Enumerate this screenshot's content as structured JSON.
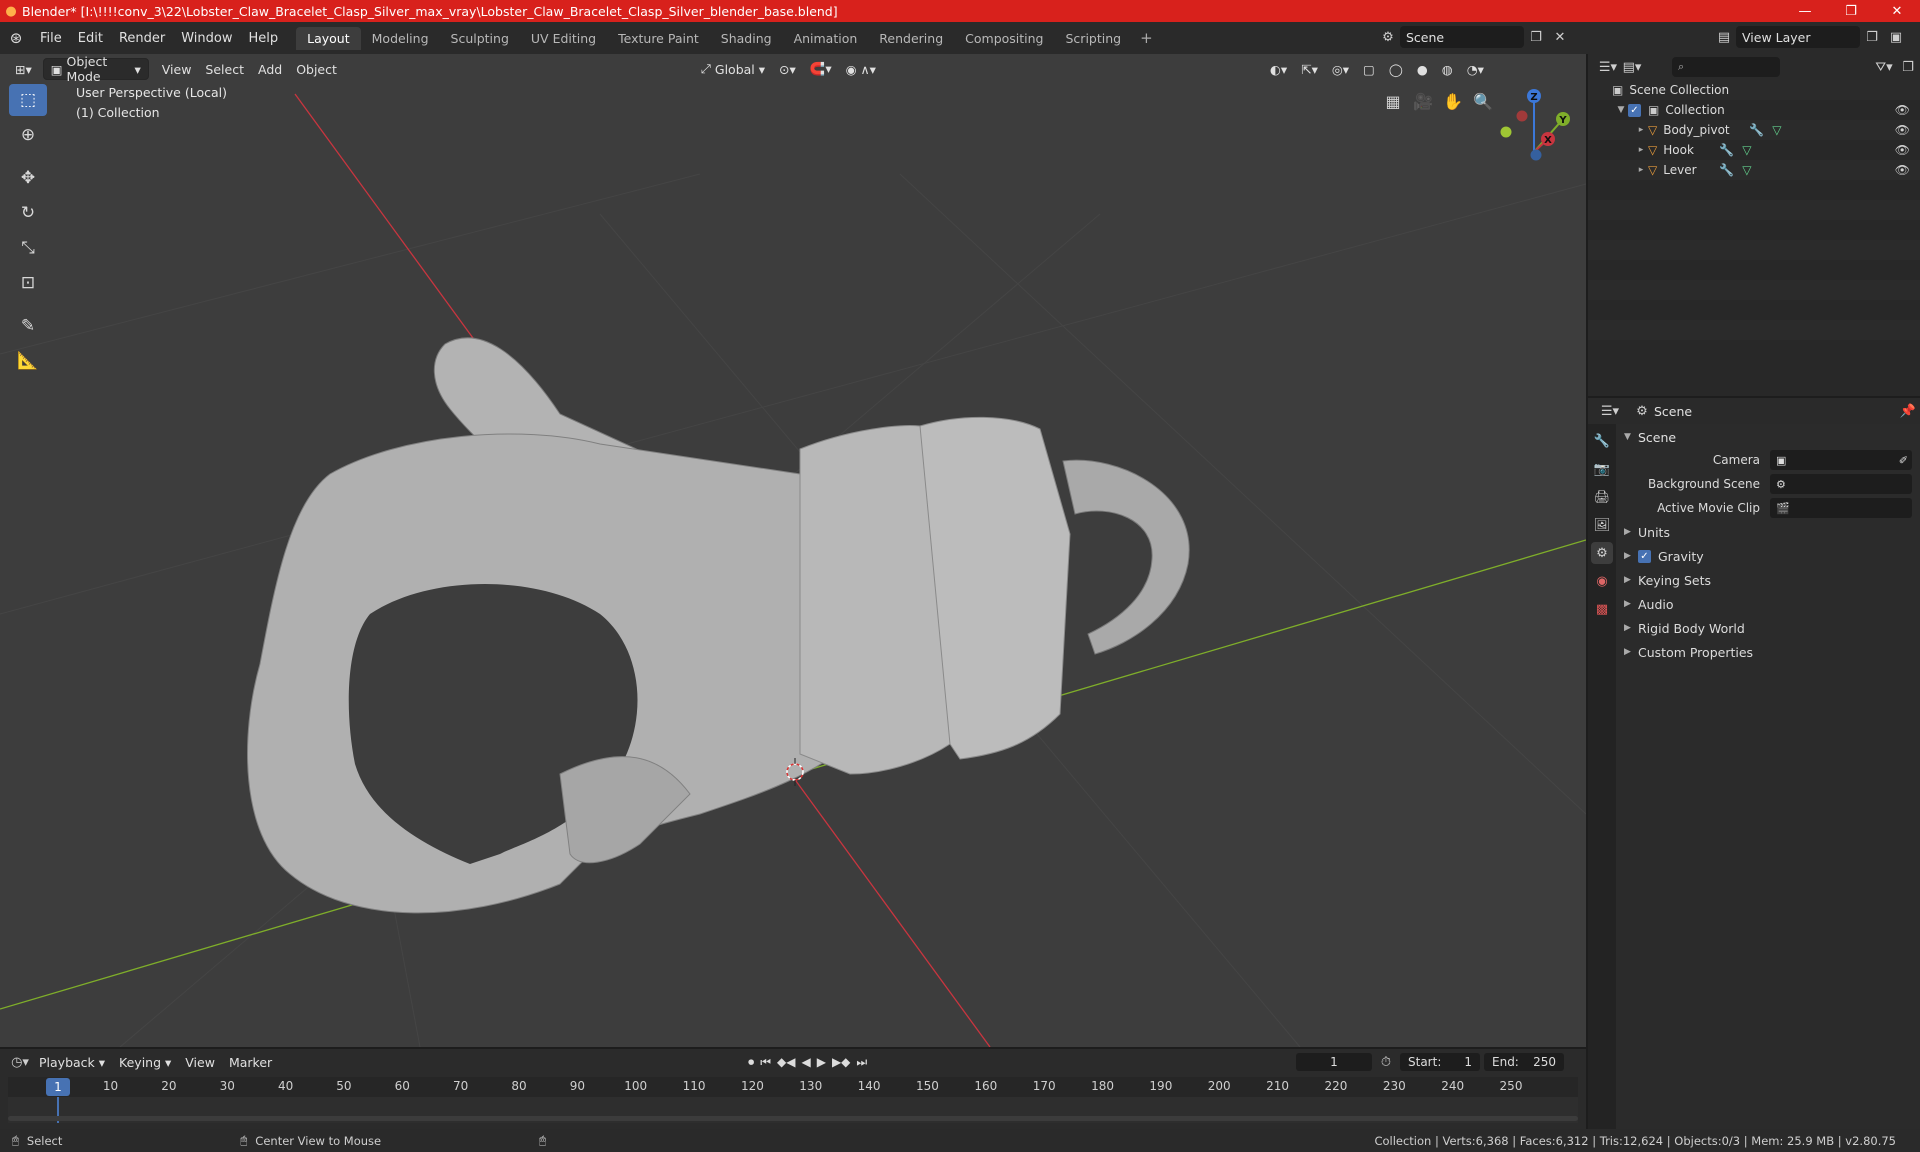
{
  "window": {
    "title": "Blender* [I:\\!!!!conv_3\\22\\Lobster_Claw_Bracelet_Clasp_Silver_max_vray\\Lobster_Claw_Bracelet_Clasp_Silver_blender_base.blend]",
    "minimize": "—",
    "maximize": "❐",
    "close": "✕"
  },
  "menu": {
    "items": [
      "File",
      "Edit",
      "Render",
      "Window",
      "Help"
    ]
  },
  "workspaces": [
    "Layout",
    "Modeling",
    "Sculpting",
    "UV Editing",
    "Texture Paint",
    "Shading",
    "Animation",
    "Rendering",
    "Compositing",
    "Scripting"
  ],
  "active_workspace": "Layout",
  "scene_selector": {
    "value": "Scene"
  },
  "view_layer_selector": {
    "value": "View Layer"
  },
  "viewport": {
    "mode": "Object Mode",
    "menus": [
      "View",
      "Select",
      "Add",
      "Object"
    ],
    "transform_orientation": "Global",
    "perspective_label": "User Perspective (Local)",
    "collection_label": "(1) Collection",
    "gizmo": {
      "x": "X",
      "y": "Y",
      "z": "Z"
    }
  },
  "outliner": {
    "search_placeholder": "",
    "root": "Scene Collection",
    "collection": "Collection",
    "objects": [
      "Body_pivot",
      "Hook",
      "Lever"
    ]
  },
  "properties": {
    "context": "Scene",
    "panel": "Scene",
    "fields": [
      {
        "label": "Camera",
        "value": ""
      },
      {
        "label": "Background Scene",
        "value": ""
      },
      {
        "label": "Active Movie Clip",
        "value": ""
      }
    ],
    "subpanels": [
      "Units",
      "Gravity",
      "Keying Sets",
      "Audio",
      "Rigid Body World",
      "Custom Properties"
    ],
    "gravity_enabled": true
  },
  "timeline": {
    "menus": [
      "Playback",
      "Keying",
      "View",
      "Marker"
    ],
    "current_frame": "1",
    "start_label": "Start:",
    "start": "1",
    "end_label": "End:",
    "end": "250",
    "ruler_ticks": [
      "10",
      "20",
      "30",
      "40",
      "50",
      "60",
      "70",
      "80",
      "90",
      "100",
      "110",
      "120",
      "130",
      "140",
      "150",
      "160",
      "170",
      "180",
      "190",
      "200",
      "210",
      "220",
      "230",
      "240",
      "250"
    ],
    "ruler_current": "1"
  },
  "statusbar": {
    "left_action": "Select",
    "middle_action": "Center View to Mouse",
    "stats": "Collection | Verts:6,368 | Faces:6,312 | Tris:12,624 | Objects:0/3 | Mem: 25.9 MB | v2.80.75"
  },
  "colors": {
    "accent": "#4772b3",
    "title_bar": "#d8211c",
    "x_axis": "#c8353f",
    "y_axis": "#7fae2a",
    "z_axis": "#3c78d8"
  }
}
